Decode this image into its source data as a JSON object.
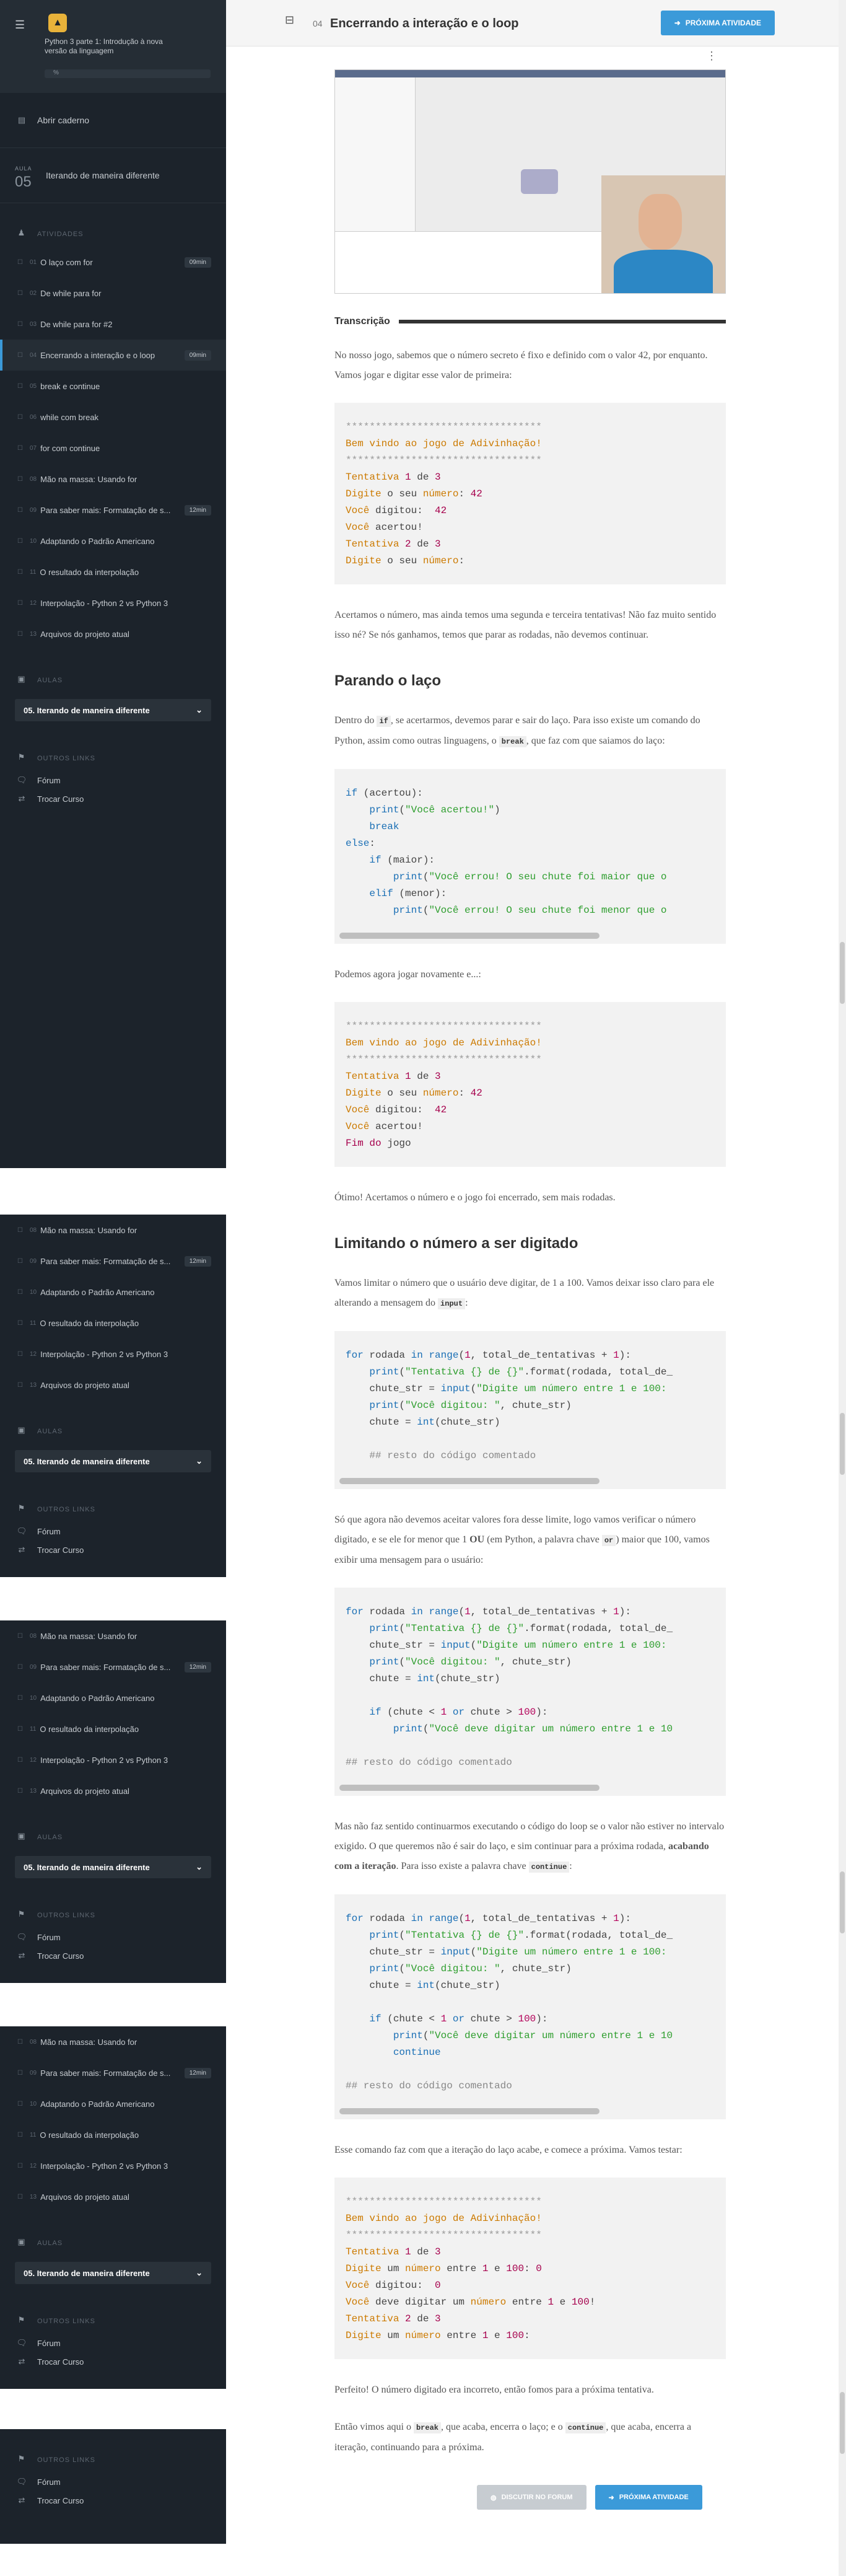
{
  "sidebar": {
    "course_title": "Python 3 parte 1: Introdução à nova versão da linguagem",
    "progress_label": "%",
    "notebook_label": "Abrir caderno",
    "lesson_label": "AULA",
    "lesson_number": "05",
    "lesson_title": "Iterando de maneira diferente",
    "activities_header": "ATIVIDADES",
    "activities": [
      {
        "num": "01",
        "label": "O laço com for",
        "time": "09min"
      },
      {
        "num": "02",
        "label": "De while para for",
        "time": ""
      },
      {
        "num": "03",
        "label": "De while para for #2",
        "time": ""
      },
      {
        "num": "04",
        "label": "Encerrando a interação e o loop",
        "time": "09min"
      },
      {
        "num": "05",
        "label": "break e continue",
        "time": ""
      },
      {
        "num": "06",
        "label": "while com break",
        "time": ""
      },
      {
        "num": "07",
        "label": "for com continue",
        "time": ""
      },
      {
        "num": "08",
        "label": "Mão na massa: Usando for",
        "time": ""
      },
      {
        "num": "09",
        "label": "Para saber mais: Formatação de s...",
        "time": "12min"
      },
      {
        "num": "10",
        "label": "Adaptando o Padrão Americano",
        "time": ""
      },
      {
        "num": "11",
        "label": "O resultado da interpolação",
        "time": ""
      },
      {
        "num": "12",
        "label": "Interpolação - Python 2 vs Python 3",
        "time": ""
      },
      {
        "num": "13",
        "label": "Arquivos do projeto atual",
        "time": ""
      }
    ],
    "aulas_header": "AULAS",
    "aula_select": "05. Iterando de maneira diferente",
    "other_links_header": "OUTROS LINKS",
    "forum_label": "Fórum",
    "change_course_label": "Trocar Curso",
    "chevron": "⌄"
  },
  "topbar": {
    "number": "04",
    "title": "Encerrando a interação e o loop",
    "next_button": "PRÓXIMA ATIVIDADE"
  },
  "transcript": {
    "header": "Transcrição",
    "p1": "No nosso jogo, sabemos que o número secreto é fixo e definido com o valor 42, por enquanto. Vamos jogar e digitar esse valor de primeira:",
    "p2": "Acertamos o número, mas ainda temos uma segunda e terceira tentativas! Não faz muito sentido isso né? Se nós ganhamos, temos que parar as rodadas, não devemos continuar.",
    "h_loop": "Parando o laço",
    "p3_a": "Dentro do ",
    "p3_code1": "if",
    "p3_b": ", se acertarmos, devemos parar e sair do laço. Para isso existe um comando do Python, assim como outras linguagens, o ",
    "p3_code2": "break",
    "p3_c": ", que faz com que saiamos do laço:",
    "p4": "Podemos agora jogar novamente e...:",
    "p5": "Ótimo! Acertamos o número e o jogo foi encerrado, sem mais rodadas.",
    "h_limit": "Limitando o número a ser digitado",
    "p6_a": "Vamos limitar o número que o usuário deve digitar, de 1 a 100. Vamos deixar isso claro para ele alterando a mensagem do ",
    "p6_code": "input",
    "p6_b": ":",
    "p7_a": "Só que agora não devemos aceitar valores fora desse limite, logo vamos verificar o número digitado, e se ele for menor que 1 ",
    "p7_ou": "OU",
    "p7_b": " (em Python, a palavra chave ",
    "p7_code": "or",
    "p7_c": ") maior que 100, vamos exibir uma mensagem para o usuário:",
    "p8_a": "Mas não faz sentido continuarmos executando o código do loop se o valor não estiver no intervalo exigido. O que queremos não é sair do laço, e sim continuar para a próxima rodada, ",
    "p8_bold": "acabando com a iteração",
    "p8_b": ". Para isso existe a palavra chave ",
    "p8_code": "continue",
    "p8_c": ":",
    "p9": "Esse comando faz com que a iteração do laço acabe, e comece a próxima. Vamos testar:",
    "p10": "Perfeito! O número digitado era incorreto, então fomos para a próxima tentativa.",
    "p11_a": "Então vimos aqui o ",
    "p11_code1": "break",
    "p11_b": ", que acaba, encerra o laço; e o ",
    "p11_code2": "continue",
    "p11_c": ", que acaba, encerra a iteração, continuando para a próxima."
  },
  "buttons": {
    "forum": "DISCUTIR NO FORUM",
    "next": "PRÓXIMA ATIVIDADE"
  },
  "colors": {
    "accent": "#3b9ad9",
    "sidebar": "#1c232b"
  }
}
